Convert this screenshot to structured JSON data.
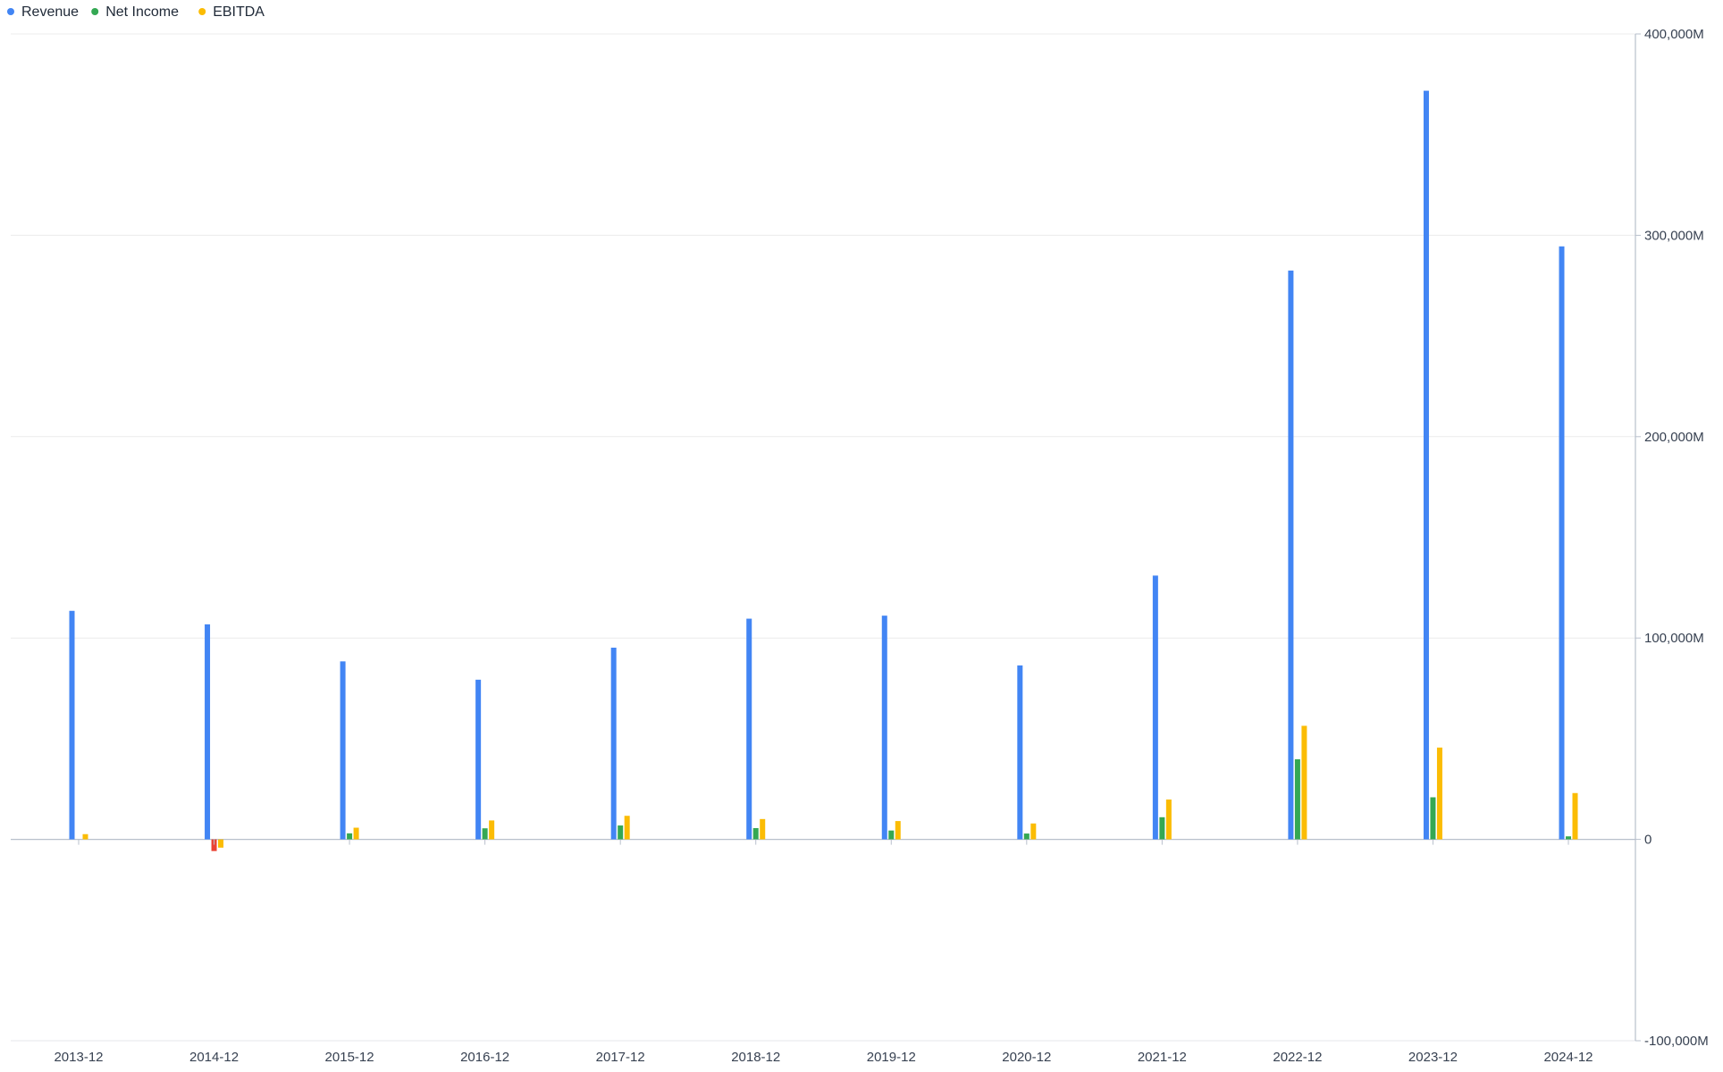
{
  "chart_data": {
    "type": "bar",
    "categories": [
      "2013-12",
      "2014-12",
      "2015-12",
      "2016-12",
      "2017-12",
      "2018-12",
      "2019-12",
      "2020-12",
      "2021-12",
      "2022-12",
      "2023-12",
      "2024-12"
    ],
    "series": [
      {
        "name": "Revenue",
        "color": "#4285f4",
        "values": [
          113500,
          106800,
          88400,
          79300,
          95200,
          109600,
          111100,
          86400,
          131000,
          282500,
          371800,
          294500
        ]
      },
      {
        "name": "Net Income",
        "color": "#34a853",
        "negative_color": "#ea4335",
        "values": [
          0,
          -5800,
          3000,
          5500,
          6900,
          5600,
          4400,
          2900,
          11000,
          39800,
          20900,
          1500
        ]
      },
      {
        "name": "EBITDA",
        "color": "#fbbc04",
        "values": [
          2600,
          -4100,
          5800,
          9400,
          11700,
          10100,
          9100,
          7900,
          19800,
          56400,
          45600,
          23000
        ]
      }
    ],
    "ylim": [
      -100000,
      400000
    ],
    "yticks": [
      -100000,
      0,
      100000,
      200000,
      300000,
      400000
    ],
    "ytick_labels": [
      "-100,000M",
      "0",
      "100,000M",
      "200,000M",
      "300,000M",
      "400,000M"
    ],
    "y_axis_position": "right",
    "grid": true,
    "legend_position": "top-left",
    "title": "",
    "xlabel": "",
    "ylabel": ""
  }
}
